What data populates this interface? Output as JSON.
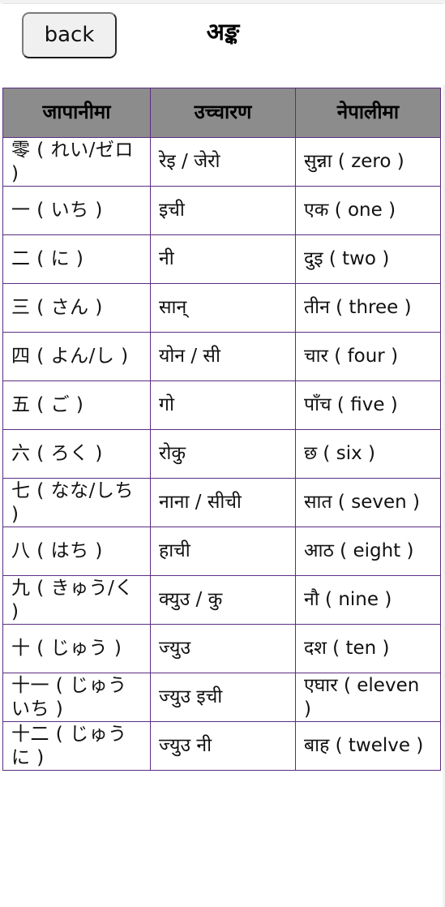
{
  "header": {
    "back_label": "back",
    "title": "अङ्क"
  },
  "table": {
    "columns": [
      "जापानीमा",
      "उच्चारण",
      "नेपालीमा"
    ],
    "rows": [
      {
        "japanese": "零 ( れい/ゼロ )",
        "pronunciation": "रेइ / जेरो",
        "nepali": "सुन्ना ( zero )"
      },
      {
        "japanese": "一 ( いち )",
        "pronunciation": "इची",
        "nepali": "एक ( one )"
      },
      {
        "japanese": "二 ( に )",
        "pronunciation": "नी",
        "nepali": "दुइ ( two )"
      },
      {
        "japanese": "三 ( さん )",
        "pronunciation": "सान्",
        "nepali": "तीन ( three )"
      },
      {
        "japanese": "四 ( よん/し )",
        "pronunciation": "योन / सी",
        "nepali": "चार ( four )"
      },
      {
        "japanese": "五 ( ご )",
        "pronunciation": "गो",
        "nepali": "पाँच ( five )"
      },
      {
        "japanese": "六 ( ろく )",
        "pronunciation": "रोकु",
        "nepali": "छ ( six )"
      },
      {
        "japanese": "七 ( なな/しち )",
        "pronunciation": "नाना / सीची",
        "nepali": "सात ( seven )"
      },
      {
        "japanese": "八 ( はち )",
        "pronunciation": "हाची",
        "nepali": "आठ ( eight )"
      },
      {
        "japanese": "九 ( きゅう/く )",
        "pronunciation": "क्युउ / कु",
        "nepali": "नौ ( nine )"
      },
      {
        "japanese": "十 ( じゅう )",
        "pronunciation": "ज्युउ",
        "nepali": "दश ( ten )"
      },
      {
        "japanese": "十一 ( じゅういち )",
        "pronunciation": "ज्युउ इची",
        "nepali": "एघार ( eleven )"
      },
      {
        "japanese": "十二 ( じゅうに )",
        "pronunciation": "ज्युउ नी",
        "nepali": "बाह ( twelve )"
      }
    ]
  },
  "colors": {
    "table_border": "#5b2d82",
    "header_bg": "#8c8c8c",
    "button_bg": "#f0f0f0",
    "page_bg": "#ffffff"
  }
}
